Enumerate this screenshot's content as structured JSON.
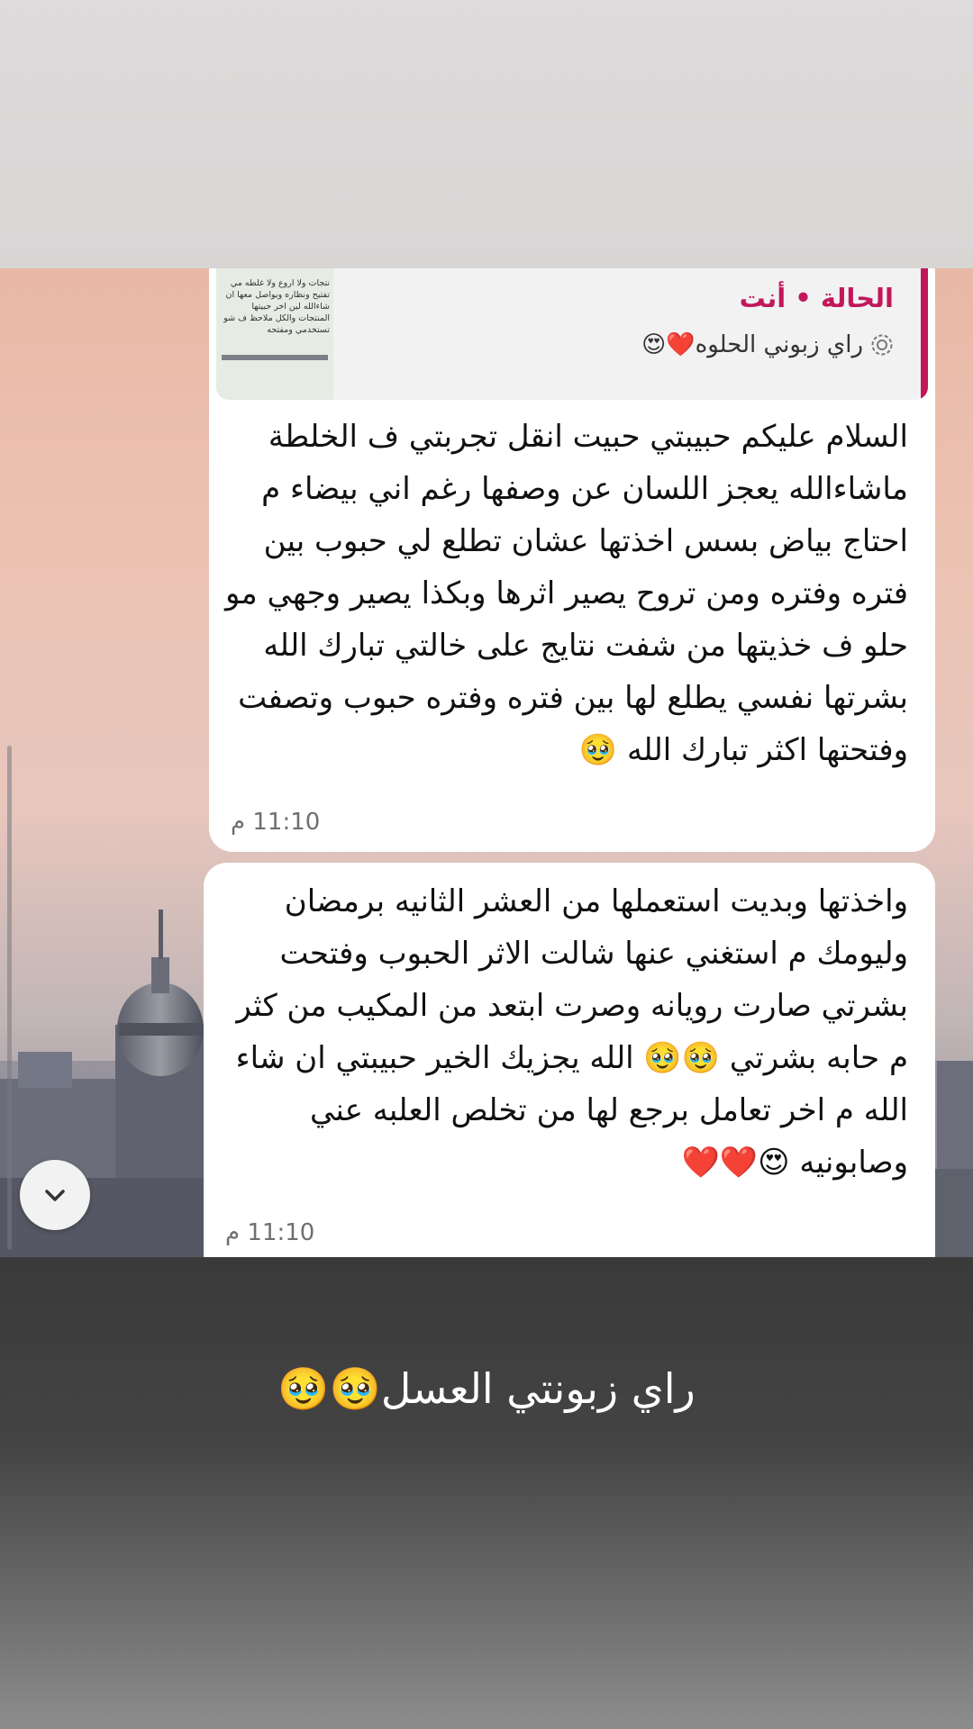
{
  "reply_quote": {
    "title": "الحالة • أنت",
    "status_line": "راي زبوني الحلوه❤️😍",
    "thumbnail_text": "نتجات ولا اروع ولا غلطه مي تفتيح ونظاره ويواصل معها ان شاءالله لين اخر حبيتها المنتجات والكل ملاحظ ف شو تستخدمي ومفتحه"
  },
  "messages": [
    {
      "text": "السلام عليكم حبيبتي حبيت انقل تجربتي ف الخلطة ماشاءالله يعجز اللسان عن وصفها رغم اني بيضاء م احتاج بياض بسس اخذتها عشان تطلع لي حبوب بين فتره وفتره ومن تروح يصير اثرها وبكذا يصير وجهي مو حلو ف خذيتها من شفت نتايج على خالتي تبارك الله بشرتها نفسي يطلع لها بين فتره وفتره حبوب وتصفت وفتحتها اكثر تبارك الله 🥹",
      "time": "11:10 م"
    },
    {
      "text": "واخذتها وبديت استعملها من العشر الثانيه برمضان وليومك م استغني عنها شالت الاثر الحبوب وفتحت بشرتي صارت رويانه وصرت ابتعد من المكيب من كثر م حابه بشرتي 🥹🥹 الله يجزيك الخير حبيبتي ان شاء الله م اخر تعامل برجع لها من تخلص العلبه عني وصابونيه 😍❤️❤️",
      "time": "11:10 م"
    }
  ],
  "caption": "راي زبونتي العسل🥹🥹",
  "icons": {
    "status": "status-ring-icon",
    "scroll": "chevron-down-icon"
  },
  "colors": {
    "accent": "#c2185b",
    "bubble": "#ffffff"
  }
}
